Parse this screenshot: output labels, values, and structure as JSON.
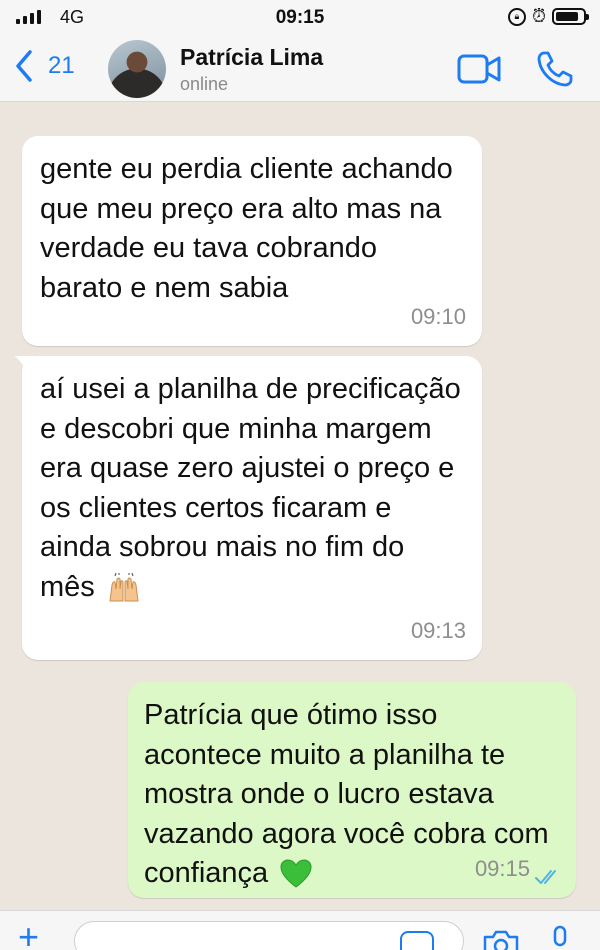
{
  "status_bar": {
    "network": "4G",
    "time": "09:15"
  },
  "header": {
    "back_count": "21",
    "contact_name": "Patrícia Lima",
    "contact_status": "online"
  },
  "messages": [
    {
      "direction": "incoming",
      "text": "gente eu perdia cliente achando que meu preço era alto mas na verdade eu tava cobrando barato e nem sabia",
      "time": "09:10"
    },
    {
      "direction": "incoming",
      "text": "aí usei a planilha de precificação e descobri que minha margem era quase zero ajustei o preço e os clientes certos ficaram e ainda sobrou mais no fim do mês",
      "emoji": "raising-hands",
      "time": "09:13"
    },
    {
      "direction": "outgoing",
      "text": "Patrícia que ótimo isso acontece muito a planilha te mostra onde o lucro estava vazando agora você cobra com confiança",
      "emoji": "green-heart",
      "time": "09:15",
      "read_status": "read"
    }
  ],
  "icons": {
    "back": "chevron-left-icon",
    "video": "video-call-icon",
    "call": "phone-icon",
    "add": "plus-icon",
    "camera": "camera-icon",
    "mic": "microphone-icon"
  },
  "colors": {
    "accent": "#1e7cf2",
    "incoming_bubble": "#ffffff",
    "outgoing_bubble": "#dcf8c6",
    "chat_background": "#ece5dd",
    "read_ticks": "#4fb3e8"
  }
}
